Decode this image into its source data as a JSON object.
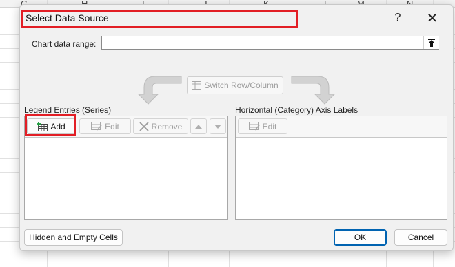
{
  "spreadsheet": {
    "column_headers": [
      "C",
      "H",
      "I",
      "J",
      "K",
      "L",
      "M",
      "N"
    ]
  },
  "dialog": {
    "title": "Select Data Source",
    "help_label": "?",
    "close_label": "✕",
    "chart_data_range": {
      "label": "Chart data range:",
      "value": ""
    },
    "switch_button": "Switch Row/Column",
    "legend_entries": {
      "heading": "Legend Entries (Series)",
      "add_label": "Add",
      "edit_label": "Edit",
      "remove_label": "Remove",
      "items": []
    },
    "axis_labels": {
      "heading": "Horizontal (Category) Axis Labels",
      "edit_label": "Edit",
      "items": []
    },
    "hidden_empty_cells_label": "Hidden and Empty Cells",
    "ok_label": "OK",
    "cancel_label": "Cancel"
  },
  "colors": {
    "highlight": "#e21e25",
    "default_button_border": "#0063b1"
  }
}
